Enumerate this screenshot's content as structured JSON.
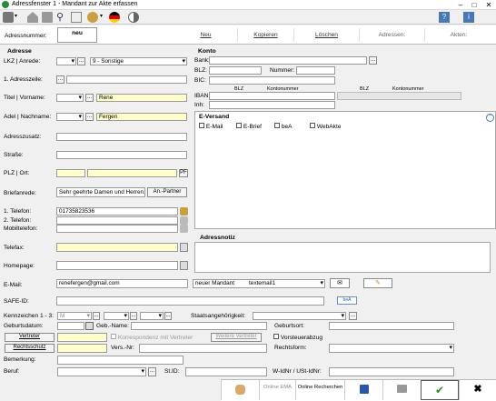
{
  "window": {
    "title": "Adressfenster 1 - Mandant zur Akte erfassen"
  },
  "commands": {
    "adressnummer_label": "Adressnummer:",
    "adressnummer_value": "neu",
    "neu": "Neu",
    "kopieren": "Kopieren",
    "loeschen": "Löschen",
    "adressen": "Adressen:",
    "akten": "Akten:"
  },
  "address": {
    "section": "Adresse",
    "lkz_label": "LKZ | Anrede:",
    "anrede_value": "9   - Sonstige",
    "adresszeile_label": "1. Adresszeile:",
    "titel_label": "Titel | Vorname:",
    "vorname": "Rene",
    "adel_label": "Adel | Nachname:",
    "nachname": "Fergen",
    "adresszusatz_label": "Adresszusatz:",
    "strasse_label": "Straße:",
    "plz_label": "PLZ | Ort:",
    "pf": "PF",
    "briefanrede_label": "Briefanrede:",
    "briefanrede": "Sehr geehrte Damen und Herren,",
    "an_partner": "An.-Partner",
    "telefon1_label": "1. Telefon:",
    "telefon1": "01735823536",
    "telefon2_label": "2. Telefon:",
    "mobil_label": "Mobiltelefon:",
    "telefax_label": "Telefax:",
    "homepage_label": "Homepage:",
    "email_label": "E-Mail:",
    "email": "renefergen@gmail.com",
    "safe_label": "SAFE-ID:"
  },
  "konto": {
    "section": "Konto",
    "bank": "Bank:",
    "blz": "BLZ:",
    "nummer": "Nummer:",
    "bic": "BIC:",
    "iban": "IBAN:",
    "inh": "Inh:",
    "col_blz": "BLZ",
    "col_konto": "Kontonummer",
    "col_blz2": "BLZ",
    "col_konto2": "Kontonummer"
  },
  "eversand": {
    "section": "E-Versand",
    "options": [
      "E-Mail",
      "E-Brief",
      "beA",
      "WebAkte"
    ]
  },
  "notiz": {
    "section": "Adressnotiz"
  },
  "email_row": {
    "neuer_mandant": "neuer Mandant",
    "texteemail": "textemail1"
  },
  "bottom": {
    "kennzeichen_label": "Kennzeichen 1 - 3:",
    "kennz1": "M",
    "staat_label": "Staatsangehörigkeit:",
    "geburtsdatum_label": "Geburtsdatum:",
    "gebname_label": "Geb.-Name:",
    "geburtsort_label": "Geburtsort:",
    "vertreter": "Vertreter",
    "korrespondenz": "Korrespondenz mit Vertreter",
    "weitere_vertreter": "Weitere Vertreter",
    "vorsteuer": "Vorsteuerabzug",
    "rechtsschutz": "Rechtsschutz",
    "versnr_label": "Vers.-Nr:",
    "rechtsform_label": "Rechtsform:",
    "bemerkung_label": "Bemerkung:",
    "beruf_label": "Beruf:",
    "stid_label": "St.ID:",
    "wid_label": "W-IdNr / USt-IdNr:"
  },
  "footer": {
    "online_ema": "Online EMA",
    "online_recherchen": "Online Recherchen"
  },
  "colors": {
    "yellow": "#ffffcc",
    "ok_green": "#2e8b2e",
    "help_blue": "#4a78b5"
  }
}
